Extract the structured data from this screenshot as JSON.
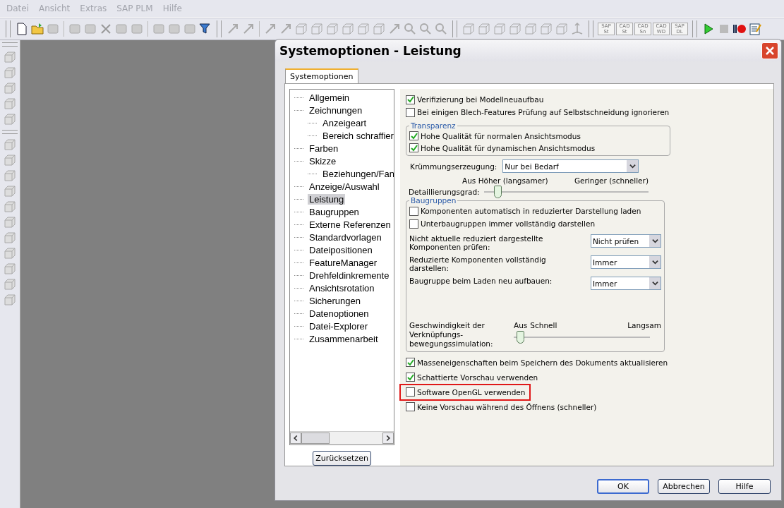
{
  "menu": [
    {
      "label": "Datei",
      "disabled": true
    },
    {
      "label": "Ansicht",
      "disabled": true
    },
    {
      "label": "Extras",
      "disabled": true
    },
    {
      "label": "SAP PLM",
      "disabled": true
    },
    {
      "label": "Hilfe",
      "disabled": true
    }
  ],
  "toolbar_text_icons": [
    {
      "top": "SAP",
      "bottom": "St"
    },
    {
      "top": "CAD",
      "bottom": "St"
    },
    {
      "top": "CAD",
      "bottom": "Sn"
    },
    {
      "top": "CAD",
      "bottom": "WD"
    },
    {
      "top": "SAP",
      "bottom": "DL"
    }
  ],
  "dialog": {
    "title": "Systemoptionen - Leistung",
    "tabs": [
      {
        "label": "Systemoptionen",
        "selected": true
      }
    ],
    "tree": [
      {
        "label": "Allgemein",
        "selected": false
      },
      {
        "label": "Zeichnungen",
        "selected": false,
        "children": [
          {
            "label": "Anzeigeart",
            "selected": false
          },
          {
            "label": "Bereich schraffier",
            "selected": false
          }
        ]
      },
      {
        "label": "Farben",
        "selected": false
      },
      {
        "label": "Skizze",
        "selected": false,
        "children": [
          {
            "label": "Beziehungen/Fan",
            "selected": false
          }
        ]
      },
      {
        "label": "Anzeige/Auswahl",
        "selected": false
      },
      {
        "label": "Leistung",
        "selected": true
      },
      {
        "label": "Baugruppen",
        "selected": false
      },
      {
        "label": "Externe Referenzen",
        "selected": false
      },
      {
        "label": "Standardvorlagen",
        "selected": false
      },
      {
        "label": "Dateipositionen",
        "selected": false
      },
      {
        "label": "FeatureManager",
        "selected": false
      },
      {
        "label": "Drehfeldinkremente",
        "selected": false
      },
      {
        "label": "Ansichtsrotation",
        "selected": false
      },
      {
        "label": "Sicherungen",
        "selected": false
      },
      {
        "label": "Datenoptionen",
        "selected": false
      },
      {
        "label": "Datei-Explorer",
        "selected": false
      },
      {
        "label": "Zusammenarbeit",
        "selected": false
      }
    ],
    "reset_button": "Zurücksetzen",
    "top_options": [
      {
        "label": "Verifizierung bei Modellneuaufbau",
        "checked": true
      },
      {
        "label": "Bei einigen Blech-Features Prüfung auf Selbstschneidung ignorieren",
        "checked": false
      }
    ],
    "transparency": {
      "title": "Transparenz",
      "options": [
        {
          "label": "Hohe Qualität für normalen Ansichtsmodus",
          "checked": true
        },
        {
          "label": "Hohe Qualität für dynamischen Ansichtsmodus",
          "checked": true
        }
      ]
    },
    "curvature": {
      "label": "Krümmungserzeugung:",
      "value": "Nur bei Bedarf"
    },
    "detail_slider": {
      "label": "Detaillierungsgrad:",
      "left_label": "Aus Höher (langsamer)",
      "right_label": "Geringer (schneller)",
      "level": 0.06
    },
    "assemblies": {
      "title": "Baugruppen",
      "options": [
        {
          "label": "Komponenten automatisch in reduzierter Darstellung laden",
          "checked": false
        },
        {
          "label": "Unterbaugruppen immer vollständig darstellen",
          "checked": false
        }
      ],
      "selects": [
        {
          "label": "Nicht aktuelle reduziert dargestellte Komponenten prüfen:",
          "value": "Nicht prüfen"
        },
        {
          "label": "Reduzierte Komponenten vollständig darstellen:",
          "value": "Immer"
        },
        {
          "label": "Baugruppe beim Laden neu aufbauen:",
          "value": "Immer"
        }
      ],
      "simulation_slider": {
        "label": "Geschwindigkeit der Verknüpfungs-bewegungssimulation:",
        "off_label": "Aus",
        "left_label": "Schnell",
        "right_label": "Langsam",
        "level": 0.02
      }
    },
    "bottom_options": [
      {
        "label": "Masseneigenschaften beim Speichern des Dokuments aktualisieren",
        "checked": true,
        "highlighted": false
      },
      {
        "label": "Schattierte Vorschau verwenden",
        "checked": true,
        "highlighted": false
      },
      {
        "label": "Software OpenGL verwenden",
        "checked": false,
        "highlighted": true
      },
      {
        "label": "Keine Vorschau während des Öffnens (schneller)",
        "checked": false,
        "highlighted": false
      }
    ],
    "buttons": [
      {
        "label": "OK",
        "default": true
      },
      {
        "label": "Abbrechen",
        "default": false
      },
      {
        "label": "Hilfe",
        "default": false
      }
    ]
  }
}
